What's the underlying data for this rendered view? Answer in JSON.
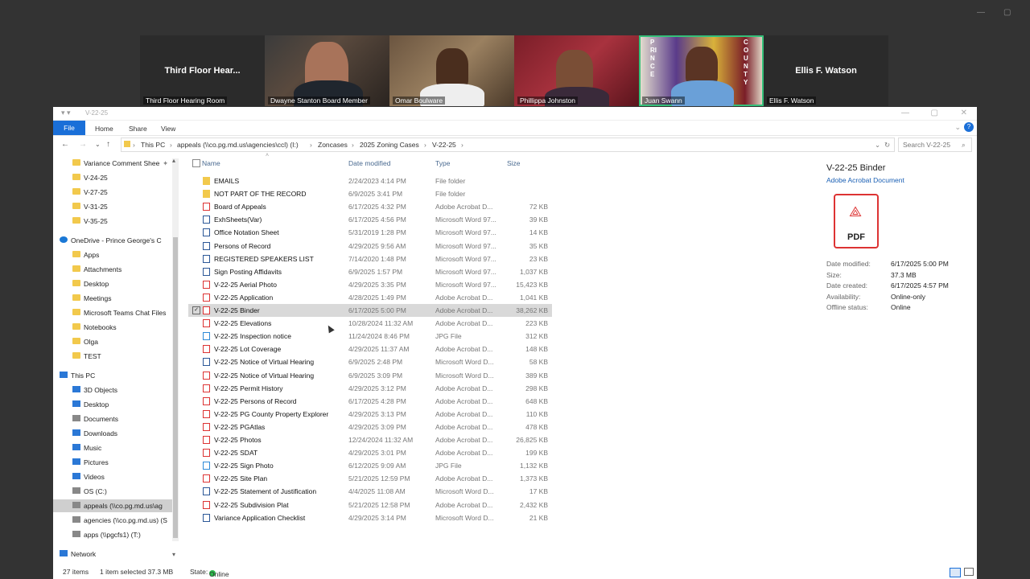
{
  "meeting": {
    "participants": [
      {
        "name": "Third Floor Hear...",
        "caption": "Third Floor Hearing Room",
        "video": false
      },
      {
        "name": "",
        "caption": "Dwayne Stanton  Board Member",
        "video": true
      },
      {
        "name": "",
        "caption": "Omar Boulware",
        "video": true
      },
      {
        "name": "",
        "caption": "Phillippa Johnston",
        "video": true
      },
      {
        "name": "",
        "caption": "Juan Swann",
        "video": true,
        "active": true
      },
      {
        "name": "Ellis F. Watson",
        "caption": "Ellis F. Watson",
        "video": false
      }
    ],
    "flag_left": "PRINCE",
    "flag_right": "COUNTY"
  },
  "window": {
    "title": "V-22-25",
    "ribbon_tabs": [
      "File",
      "Home",
      "Share",
      "View"
    ],
    "help": "?"
  },
  "address": {
    "segments": [
      "This PC",
      "appeals (\\\\co.pg.md.us\\agencies\\ccl) (I:)",
      "Zoncases",
      "2025 Zoning Cases",
      "V-22-25"
    ],
    "search_placeholder": "Search V-22-25"
  },
  "nav": [
    {
      "label": "Variance Comment Shee",
      "icon": "folder",
      "pinned": true
    },
    {
      "label": "V-24-25",
      "icon": "folder"
    },
    {
      "label": "V-27-25",
      "icon": "folder"
    },
    {
      "label": "V-31-25",
      "icon": "folder"
    },
    {
      "label": "V-35-25",
      "icon": "folder"
    },
    {
      "label": "OneDrive - Prince George's C",
      "icon": "cloud"
    },
    {
      "label": "Apps",
      "icon": "folder"
    },
    {
      "label": "Attachments",
      "icon": "folder"
    },
    {
      "label": "Desktop",
      "icon": "folder"
    },
    {
      "label": "Meetings",
      "icon": "folder"
    },
    {
      "label": "Microsoft Teams Chat Files",
      "icon": "folder"
    },
    {
      "label": "Notebooks",
      "icon": "folder"
    },
    {
      "label": "Olga",
      "icon": "folder"
    },
    {
      "label": "TEST",
      "icon": "folder"
    },
    {
      "label": "This PC",
      "icon": "pc"
    },
    {
      "label": "3D Objects",
      "icon": "blue"
    },
    {
      "label": "Desktop",
      "icon": "blue"
    },
    {
      "label": "Documents",
      "icon": "gray"
    },
    {
      "label": "Downloads",
      "icon": "blue"
    },
    {
      "label": "Music",
      "icon": "blue"
    },
    {
      "label": "Pictures",
      "icon": "blue"
    },
    {
      "label": "Videos",
      "icon": "blue"
    },
    {
      "label": "OS (C:)",
      "icon": "gray"
    },
    {
      "label": "appeals (\\\\co.pg.md.us\\ag",
      "icon": "gray",
      "selected": true
    },
    {
      "label": "agencies (\\\\co.pg.md.us) (S",
      "icon": "gray"
    },
    {
      "label": "apps (\\\\pgcfs1) (T:)",
      "icon": "gray"
    },
    {
      "label": "Network",
      "icon": "blue"
    }
  ],
  "columns": {
    "name": "Name",
    "date": "Date modified",
    "type": "Type",
    "size": "Size"
  },
  "files": [
    {
      "name": "EMAILS",
      "date": "2/24/2023 4:14 PM",
      "type": "File folder",
      "size": "",
      "kind": "folder"
    },
    {
      "name": "NOT PART OF THE RECORD",
      "date": "6/9/2025 3:41 PM",
      "type": "File folder",
      "size": "",
      "kind": "folder"
    },
    {
      "name": "Board of Appeals",
      "date": "6/17/2025 4:32 PM",
      "type": "Adobe Acrobat D...",
      "size": "72 KB",
      "kind": "pdf"
    },
    {
      "name": "ExhSheets(Var)",
      "date": "6/17/2025 4:56 PM",
      "type": "Microsoft Word 97...",
      "size": "39 KB",
      "kind": "word"
    },
    {
      "name": "Office Notation Sheet",
      "date": "5/31/2019 1:28 PM",
      "type": "Microsoft Word 97...",
      "size": "14 KB",
      "kind": "word"
    },
    {
      "name": "Persons of Record",
      "date": "4/29/2025 9:56 AM",
      "type": "Microsoft Word 97...",
      "size": "35 KB",
      "kind": "word"
    },
    {
      "name": "REGISTERED SPEAKERS LIST",
      "date": "7/14/2020 1:48 PM",
      "type": "Microsoft Word 97...",
      "size": "23 KB",
      "kind": "word"
    },
    {
      "name": "Sign Posting Affidavits",
      "date": "6/9/2025 1:57 PM",
      "type": "Microsoft Word 97...",
      "size": "1,037 KB",
      "kind": "word"
    },
    {
      "name": "V-22-25 Aerial Photo",
      "date": "4/29/2025 3:35 PM",
      "type": "Microsoft Word 97...",
      "size": "15,423 KB",
      "kind": "pdf"
    },
    {
      "name": "V-22-25 Application",
      "date": "4/28/2025 1:49 PM",
      "type": "Adobe Acrobat D...",
      "size": "1,041 KB",
      "kind": "pdf"
    },
    {
      "name": "V-22-25 Binder",
      "date": "6/17/2025 5:00 PM",
      "type": "Adobe Acrobat D...",
      "size": "38,262 KB",
      "kind": "pdf",
      "selected": true
    },
    {
      "name": "V-22-25 Elevations",
      "date": "10/28/2024 11:32 AM",
      "type": "Adobe Acrobat D...",
      "size": "223 KB",
      "kind": "pdf"
    },
    {
      "name": "V-22-25 Inspection notice",
      "date": "11/24/2024 8:46 PM",
      "type": "JPG File",
      "size": "312 KB",
      "kind": "jpg"
    },
    {
      "name": "V-22-25 Lot Coverage",
      "date": "4/29/2025 11:37 AM",
      "type": "Adobe Acrobat D...",
      "size": "148 KB",
      "kind": "pdf"
    },
    {
      "name": "V-22-25 Notice of Virtual Hearing",
      "date": "6/9/2025 2:48 PM",
      "type": "Microsoft Word D...",
      "size": "58 KB",
      "kind": "word"
    },
    {
      "name": "V-22-25 Notice of Virtual Hearing",
      "date": "6/9/2025 3:09 PM",
      "type": "Microsoft Word D...",
      "size": "389 KB",
      "kind": "pdf"
    },
    {
      "name": "V-22-25 Permit History",
      "date": "4/29/2025 3:12 PM",
      "type": "Adobe Acrobat D...",
      "size": "298 KB",
      "kind": "pdf"
    },
    {
      "name": "V-22-25 Persons of Record",
      "date": "6/17/2025 4:28 PM",
      "type": "Adobe Acrobat D...",
      "size": "648 KB",
      "kind": "pdf"
    },
    {
      "name": "V-22-25 PG County Property Explorer",
      "date": "4/29/2025 3:13 PM",
      "type": "Adobe Acrobat D...",
      "size": "110 KB",
      "kind": "pdf"
    },
    {
      "name": "V-22-25 PGAtlas",
      "date": "4/29/2025 3:09 PM",
      "type": "Adobe Acrobat D...",
      "size": "478 KB",
      "kind": "pdf"
    },
    {
      "name": "V-22-25 Photos",
      "date": "12/24/2024 11:32 AM",
      "type": "Adobe Acrobat D...",
      "size": "26,825 KB",
      "kind": "pdf"
    },
    {
      "name": "V-22-25 SDAT",
      "date": "4/29/2025 3:01 PM",
      "type": "Adobe Acrobat D...",
      "size": "199 KB",
      "kind": "pdf"
    },
    {
      "name": "V-22-25 Sign Photo",
      "date": "6/12/2025 9:09 AM",
      "type": "JPG File",
      "size": "1,132 KB",
      "kind": "jpg"
    },
    {
      "name": "V-22-25 Site Plan",
      "date": "5/21/2025 12:59 PM",
      "type": "Adobe Acrobat D...",
      "size": "1,373 KB",
      "kind": "pdf"
    },
    {
      "name": "V-22-25 Statement of Justification",
      "date": "4/4/2025 11:08 AM",
      "type": "Microsoft Word D...",
      "size": "17 KB",
      "kind": "word"
    },
    {
      "name": "V-22-25 Subdivision Plat",
      "date": "5/21/2025 12:58 PM",
      "type": "Adobe Acrobat D...",
      "size": "2,432 KB",
      "kind": "pdf"
    },
    {
      "name": "Variance Application Checklist",
      "date": "4/29/2025 3:14 PM",
      "type": "Microsoft Word D...",
      "size": "21 KB",
      "kind": "word"
    }
  ],
  "details": {
    "title": "V-22-25 Binder",
    "subtitle": "Adobe Acrobat Document",
    "icon_label": "PDF",
    "props": [
      {
        "k": "Date modified:",
        "v": "6/17/2025 5:00 PM"
      },
      {
        "k": "Size:",
        "v": "37.3 MB"
      },
      {
        "k": "Date created:",
        "v": "6/17/2025 4:57 PM"
      },
      {
        "k": "Availability:",
        "v": "Online-only"
      },
      {
        "k": "Offline status:",
        "v": "Online"
      }
    ]
  },
  "status": {
    "items": "27 items",
    "selected": "1 item selected  37.3 MB",
    "state_label": "State:",
    "state_value": "Online"
  }
}
